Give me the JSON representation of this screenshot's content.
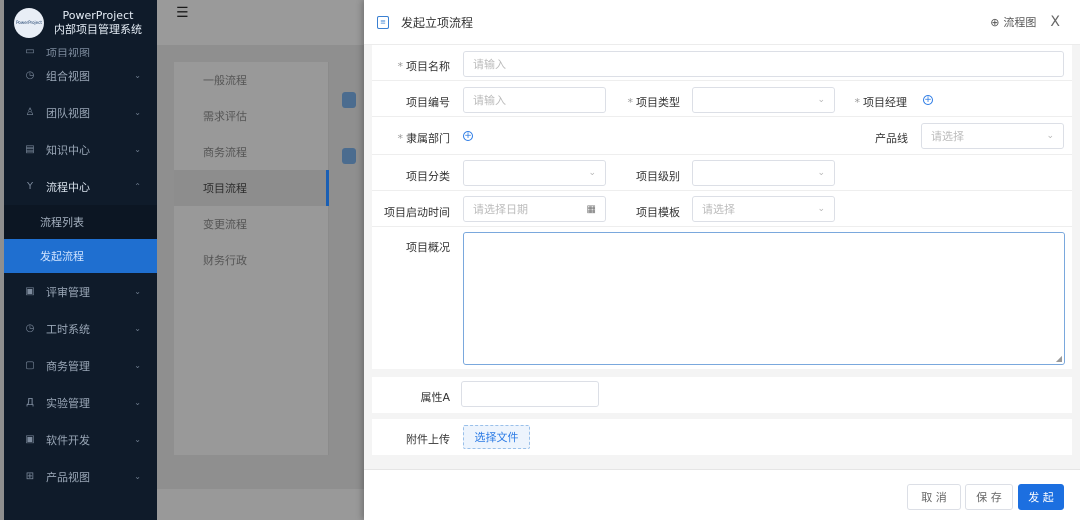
{
  "app": {
    "title": "PowerProject",
    "subtitle": "内部项目管理系统",
    "logo_text": "PowerProject"
  },
  "sidebar": {
    "cut_item": "项目视图",
    "items": [
      {
        "label": "组合视图",
        "icon": "clock-icon"
      },
      {
        "label": "团队视图",
        "icon": "team-icon"
      },
      {
        "label": "知识中心",
        "icon": "book-icon"
      },
      {
        "label": "流程中心",
        "icon": "flow-icon",
        "expanded": true
      },
      {
        "label": "评审管理",
        "icon": "review-icon"
      },
      {
        "label": "工时系统",
        "icon": "timer-icon"
      },
      {
        "label": "商务管理",
        "icon": "business-icon"
      },
      {
        "label": "实验管理",
        "icon": "lab-icon"
      },
      {
        "label": "软件开发",
        "icon": "code-icon"
      },
      {
        "label": "产品视图",
        "icon": "grid-icon"
      }
    ],
    "sub_items": [
      {
        "label": "流程列表",
        "active": false
      },
      {
        "label": "发起流程",
        "active": true
      }
    ]
  },
  "process_menu": {
    "items": [
      "一般流程",
      "需求评估",
      "商务流程",
      "项目流程",
      "变更流程",
      "财务行政"
    ],
    "active_index": 3
  },
  "drawer": {
    "title": "发起立项流程",
    "flowchart_label": "流程图",
    "close_label": "X",
    "form": {
      "project_name": {
        "label": "项目名称",
        "placeholder": "请输入",
        "required": true
      },
      "project_code": {
        "label": "项目编号",
        "placeholder": "请输入"
      },
      "project_type": {
        "label": "项目类型",
        "required": true
      },
      "project_manager": {
        "label": "项目经理",
        "required": true
      },
      "department": {
        "label": "隶属部门",
        "required": true
      },
      "product_line": {
        "label": "产品线",
        "placeholder": "请选择"
      },
      "project_category": {
        "label": "项目分类"
      },
      "project_level": {
        "label": "项目级别"
      },
      "start_time": {
        "label": "项目启动时间",
        "placeholder": "请选择日期"
      },
      "project_template": {
        "label": "项目模板",
        "placeholder": "请选择"
      },
      "overview": {
        "label": "项目概况"
      },
      "attr_a": {
        "label": "属性A"
      },
      "attachment": {
        "label": "附件上传",
        "button": "选择文件"
      }
    },
    "buttons": {
      "cancel": "取 消",
      "save": "保 存",
      "submit": "发 起"
    }
  },
  "colors": {
    "primary": "#1c6fe0",
    "sidebar_bg": "#0f1b2a",
    "active_menu": "#1f6fd0"
  }
}
